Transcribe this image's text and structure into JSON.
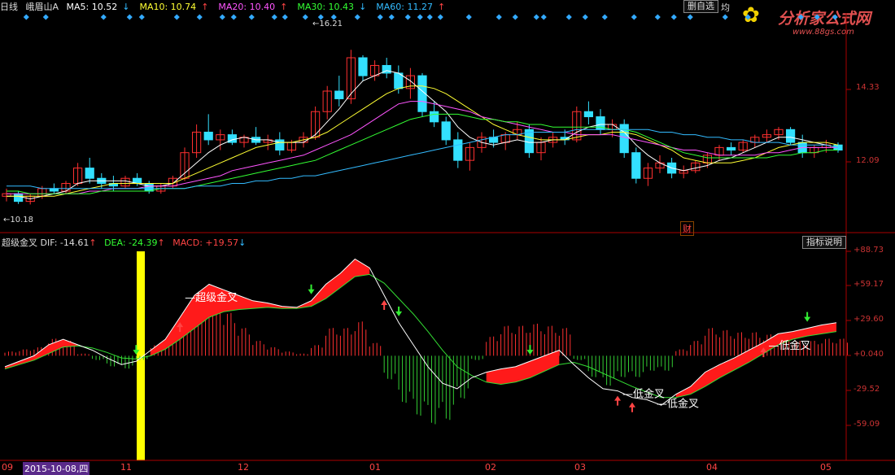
{
  "header": {
    "period": "日线",
    "stock": "峨眉山A",
    "ma": [
      {
        "label": "MA5: 10.52",
        "arrow": "↓",
        "color": "#ffffff"
      },
      {
        "label": "MA10: 10.74",
        "arrow": "↑",
        "color": "#ffff33"
      },
      {
        "label": "MA20: 10.40",
        "arrow": "↑",
        "color": "#ff55ff"
      },
      {
        "label": "MA30: 10.43",
        "arrow": "↓",
        "color": "#33ff33"
      },
      {
        "label": "MA60: 11.27",
        "arrow": "↑",
        "color": "#33bbff"
      }
    ],
    "self_select": "删自选",
    "extra": "均"
  },
  "watermark": {
    "title": "分析家公式网",
    "url": "www.88gs.com"
  },
  "price_panel": {
    "y_ticks": [
      "14.33",
      "12.09"
    ],
    "high_label": "16.21",
    "low_label": "10.18",
    "cai_label": "财"
  },
  "indicator": {
    "name": "超级金叉",
    "dif": "DIF: -14.61",
    "dif_arrow": "↑",
    "dea": "DEA: -24.39",
    "dea_arrow": "↑",
    "macd": "MACD: +19.57",
    "macd_arrow": "↓",
    "help_button": "指标说明",
    "y_ticks": [
      "+88.73",
      "+59.17",
      "+29.60",
      "+0.040",
      "-29.52",
      "-59.09"
    ]
  },
  "x_axis": {
    "cursor_date": "2015-10-08,四",
    "labels": [
      "09",
      "11",
      "12",
      "01",
      "02",
      "03",
      "04",
      "05"
    ]
  },
  "chart_data": {
    "type": "line",
    "price": {
      "ylim": [
        9.4,
        17.2
      ],
      "candles": [
        [
          10.5,
          10.8,
          10.3,
          10.6
        ],
        [
          10.6,
          10.7,
          10.2,
          10.3
        ],
        [
          10.3,
          10.6,
          10.18,
          10.5
        ],
        [
          10.5,
          10.9,
          10.4,
          10.8
        ],
        [
          10.8,
          11.0,
          10.6,
          10.7
        ],
        [
          10.7,
          11.1,
          10.6,
          11.0
        ],
        [
          11.0,
          11.8,
          10.9,
          11.6
        ],
        [
          11.6,
          12.0,
          11.0,
          11.2
        ],
        [
          11.2,
          11.4,
          10.8,
          11.0
        ],
        [
          11.0,
          11.3,
          10.7,
          10.9
        ],
        [
          10.9,
          11.3,
          10.8,
          11.2
        ],
        [
          11.2,
          11.4,
          10.9,
          11.0
        ],
        [
          11.0,
          11.1,
          10.6,
          10.7
        ],
        [
          10.7,
          11.0,
          10.6,
          10.9
        ],
        [
          10.9,
          11.3,
          10.8,
          11.2
        ],
        [
          11.2,
          12.4,
          11.1,
          12.2
        ],
        [
          12.2,
          13.3,
          12.0,
          13.0
        ],
        [
          13.0,
          13.7,
          12.5,
          12.7
        ],
        [
          12.7,
          13.1,
          12.3,
          12.9
        ],
        [
          12.9,
          13.1,
          12.5,
          12.6
        ],
        [
          12.6,
          12.9,
          12.4,
          12.8
        ],
        [
          12.8,
          13.2,
          12.5,
          12.6
        ],
        [
          12.6,
          12.9,
          12.3,
          12.7
        ],
        [
          12.7,
          13.0,
          12.1,
          12.3
        ],
        [
          12.3,
          12.7,
          12.2,
          12.6
        ],
        [
          12.6,
          13.0,
          12.4,
          12.8
        ],
        [
          12.8,
          14.0,
          12.7,
          13.8
        ],
        [
          13.8,
          14.8,
          13.5,
          14.6
        ],
        [
          14.6,
          15.2,
          14.0,
          14.3
        ],
        [
          14.3,
          16.21,
          14.1,
          15.9
        ],
        [
          15.9,
          16.0,
          15.0,
          15.2
        ],
        [
          15.2,
          15.8,
          15.0,
          15.6
        ],
        [
          15.6,
          15.9,
          15.1,
          15.3
        ],
        [
          15.3,
          15.6,
          14.5,
          14.7
        ],
        [
          14.7,
          15.5,
          14.3,
          15.2
        ],
        [
          15.2,
          15.3,
          13.6,
          13.8
        ],
        [
          13.8,
          14.2,
          13.2,
          13.4
        ],
        [
          13.4,
          13.6,
          12.5,
          12.7
        ],
        [
          12.7,
          13.0,
          11.6,
          11.9
        ],
        [
          11.9,
          12.6,
          11.5,
          12.4
        ],
        [
          12.4,
          13.0,
          12.2,
          12.8
        ],
        [
          12.8,
          13.1,
          12.4,
          12.6
        ],
        [
          12.6,
          13.0,
          12.3,
          12.9
        ],
        [
          12.9,
          13.4,
          12.7,
          13.1
        ],
        [
          13.1,
          13.3,
          12.0,
          12.2
        ],
        [
          12.2,
          12.8,
          11.9,
          12.6
        ],
        [
          12.6,
          13.0,
          12.4,
          12.8
        ],
        [
          12.8,
          13.1,
          12.5,
          12.7
        ],
        [
          12.7,
          14.0,
          12.6,
          13.8
        ],
        [
          13.8,
          14.2,
          13.3,
          13.6
        ],
        [
          13.6,
          13.9,
          12.9,
          13.1
        ],
        [
          13.1,
          13.5,
          12.8,
          13.3
        ],
        [
          13.3,
          13.5,
          12.0,
          12.2
        ],
        [
          12.2,
          12.4,
          11.0,
          11.2
        ],
        [
          11.2,
          11.8,
          10.9,
          11.6
        ],
        [
          11.6,
          12.1,
          11.4,
          11.8
        ],
        [
          11.8,
          12.0,
          11.2,
          11.4
        ],
        [
          11.4,
          11.7,
          11.2,
          11.5
        ],
        [
          11.5,
          11.9,
          11.4,
          11.8
        ],
        [
          11.8,
          12.2,
          11.6,
          12.1
        ],
        [
          12.1,
          12.5,
          11.9,
          12.4
        ],
        [
          12.4,
          12.6,
          12.1,
          12.3
        ],
        [
          12.3,
          12.7,
          12.2,
          12.6
        ],
        [
          12.6,
          12.9,
          12.4,
          12.8
        ],
        [
          12.8,
          13.1,
          12.6,
          12.9
        ],
        [
          12.9,
          13.2,
          12.7,
          13.1
        ],
        [
          13.1,
          13.2,
          12.5,
          12.6
        ],
        [
          12.6,
          12.9,
          12.0,
          12.2
        ],
        [
          12.2,
          12.5,
          12.0,
          12.4
        ],
        [
          12.4,
          12.7,
          12.2,
          12.5
        ],
        [
          12.5,
          12.6,
          12.2,
          12.3
        ]
      ],
      "ma5": [
        10.5,
        10.5,
        10.4,
        10.5,
        10.6,
        10.7,
        11.0,
        11.1,
        11.1,
        11.1,
        11.1,
        11.0,
        10.9,
        10.9,
        11.0,
        11.4,
        11.8,
        12.2,
        12.5,
        12.7,
        12.8,
        12.7,
        12.7,
        12.6,
        12.6,
        12.6,
        12.9,
        13.4,
        13.9,
        14.5,
        15.0,
        15.2,
        15.4,
        15.3,
        15.0,
        14.6,
        14.2,
        13.8,
        13.2,
        12.8,
        12.6,
        12.5,
        12.6,
        12.7,
        12.6,
        12.6,
        12.7,
        12.7,
        13.0,
        13.2,
        13.3,
        13.3,
        13.0,
        12.5,
        12.1,
        11.8,
        11.6,
        11.5,
        11.6,
        11.7,
        11.9,
        12.0,
        12.2,
        12.4,
        12.6,
        12.8,
        12.8,
        12.7,
        12.6,
        12.5,
        12.4
      ],
      "ma10": [
        10.5,
        10.5,
        10.5,
        10.5,
        10.5,
        10.6,
        10.7,
        10.8,
        10.9,
        11.0,
        11.0,
        11.0,
        11.0,
        11.0,
        11.0,
        11.2,
        11.4,
        11.6,
        11.8,
        12.0,
        12.2,
        12.4,
        12.5,
        12.6,
        12.6,
        12.7,
        12.8,
        13.0,
        13.3,
        13.6,
        13.9,
        14.2,
        14.5,
        14.7,
        14.8,
        14.8,
        14.7,
        14.5,
        14.2,
        13.9,
        13.6,
        13.3,
        13.1,
        12.9,
        12.8,
        12.7,
        12.7,
        12.7,
        12.8,
        12.9,
        12.9,
        13.0,
        13.0,
        12.9,
        12.7,
        12.5,
        12.3,
        12.0,
        11.9,
        11.8,
        11.8,
        11.8,
        11.9,
        12.0,
        12.2,
        12.4,
        12.5,
        12.6,
        12.6,
        12.6,
        12.5
      ],
      "ma20": [
        10.6,
        10.6,
        10.6,
        10.6,
        10.6,
        10.6,
        10.6,
        10.7,
        10.7,
        10.8,
        10.8,
        10.8,
        10.9,
        10.9,
        10.9,
        11.0,
        11.1,
        11.2,
        11.3,
        11.5,
        11.6,
        11.7,
        11.8,
        11.9,
        12.0,
        12.1,
        12.3,
        12.5,
        12.7,
        12.9,
        13.2,
        13.5,
        13.8,
        14.1,
        14.2,
        14.2,
        14.1,
        14.0,
        13.9,
        13.8,
        13.6,
        13.5,
        13.4,
        13.3,
        13.2,
        13.1,
        13.0,
        13.0,
        12.9,
        12.9,
        12.9,
        12.9,
        12.8,
        12.7,
        12.6,
        12.5,
        12.4,
        12.3,
        12.3,
        12.2,
        12.1,
        12.1,
        12.1,
        12.1,
        12.2,
        12.2,
        12.3,
        12.4,
        12.4,
        12.4,
        12.4
      ],
      "ma30": [
        10.7,
        10.7,
        10.6,
        10.6,
        10.6,
        10.6,
        10.6,
        10.6,
        10.7,
        10.7,
        10.7,
        10.7,
        10.7,
        10.8,
        10.8,
        10.8,
        10.9,
        11.0,
        11.1,
        11.2,
        11.3,
        11.4,
        11.5,
        11.6,
        11.7,
        11.8,
        11.9,
        12.1,
        12.3,
        12.5,
        12.7,
        12.9,
        13.1,
        13.3,
        13.5,
        13.6,
        13.7,
        13.7,
        13.7,
        13.6,
        13.5,
        13.5,
        13.4,
        13.4,
        13.3,
        13.3,
        13.2,
        13.2,
        13.2,
        13.2,
        13.2,
        13.1,
        13.1,
        13.0,
        12.8,
        12.6,
        12.4,
        12.2,
        12.1,
        12.0,
        12.0,
        12.0,
        12.0,
        12.0,
        12.0,
        12.1,
        12.1,
        12.2,
        12.2,
        12.3,
        12.3
      ],
      "ma60": [
        10.9,
        10.9,
        10.9,
        10.8,
        10.8,
        10.8,
        10.8,
        10.8,
        10.8,
        10.8,
        10.8,
        10.8,
        10.8,
        10.8,
        10.8,
        10.8,
        10.9,
        10.9,
        10.9,
        11.0,
        11.0,
        11.1,
        11.1,
        11.2,
        11.2,
        11.3,
        11.3,
        11.4,
        11.5,
        11.6,
        11.7,
        11.8,
        11.9,
        12.0,
        12.1,
        12.2,
        12.3,
        12.4,
        12.5,
        12.6,
        12.7,
        12.8,
        12.9,
        12.9,
        13.0,
        13.0,
        13.0,
        13.0,
        13.1,
        13.1,
        13.1,
        13.1,
        13.1,
        13.1,
        13.1,
        13.0,
        13.0,
        12.9,
        12.9,
        12.8,
        12.8,
        12.7,
        12.7,
        12.6,
        12.6,
        12.6,
        12.5,
        12.5,
        12.5,
        12.5,
        12.4
      ]
    },
    "indicator": {
      "ylim": [
        -90,
        95
      ],
      "dif": [
        -10,
        -5,
        0,
        10,
        15,
        10,
        5,
        -2,
        -8,
        -5,
        5,
        15,
        35,
        55,
        65,
        60,
        55,
        50,
        48,
        45,
        44,
        50,
        65,
        75,
        88,
        80,
        55,
        30,
        10,
        -10,
        -25,
        -30,
        -20,
        -15,
        -12,
        -10,
        -5,
        0,
        5,
        -8,
        -20,
        -30,
        -32,
        -38,
        -40,
        -45,
        -35,
        -28,
        -15,
        -8,
        -2,
        5,
        12,
        20,
        22,
        25,
        28,
        30
      ],
      "dea": [
        -12,
        -8,
        -4,
        2,
        8,
        9,
        7,
        3,
        -2,
        -3,
        0,
        6,
        15,
        25,
        35,
        40,
        42,
        43,
        44,
        43,
        43,
        45,
        52,
        62,
        72,
        74,
        66,
        52,
        38,
        22,
        5,
        -10,
        -18,
        -24,
        -26,
        -24,
        -20,
        -14,
        -8,
        -6,
        -10,
        -16,
        -22,
        -28,
        -33,
        -38,
        -38,
        -35,
        -28,
        -20,
        -13,
        -6,
        2,
        10,
        15,
        18,
        20,
        22
      ],
      "macd": [
        4,
        6,
        8,
        16,
        14,
        2,
        -4,
        -10,
        -12,
        -4,
        10,
        18,
        40,
        60,
        60,
        40,
        26,
        14,
        8,
        4,
        2,
        10,
        26,
        26,
        32,
        12,
        -22,
        -44,
        -56,
        -64,
        -60,
        -40,
        -4,
        18,
        28,
        28,
        30,
        28,
        26,
        -4,
        -20,
        -28,
        -20,
        -20,
        -14,
        -14,
        6,
        14,
        26,
        24,
        22,
        22,
        20,
        20,
        14,
        14,
        16,
        16
      ],
      "signals_up": [
        12,
        26,
        42,
        43,
        52
      ],
      "signals_down": [
        9,
        21,
        27,
        36,
        55
      ],
      "annotations": [
        {
          "text": "超级金叉",
          "at": 12
        },
        {
          "text": "低金叉",
          "at": 42
        },
        {
          "text": "低金叉",
          "at": 43
        },
        {
          "text": "低金叉",
          "at": 52
        }
      ]
    }
  }
}
